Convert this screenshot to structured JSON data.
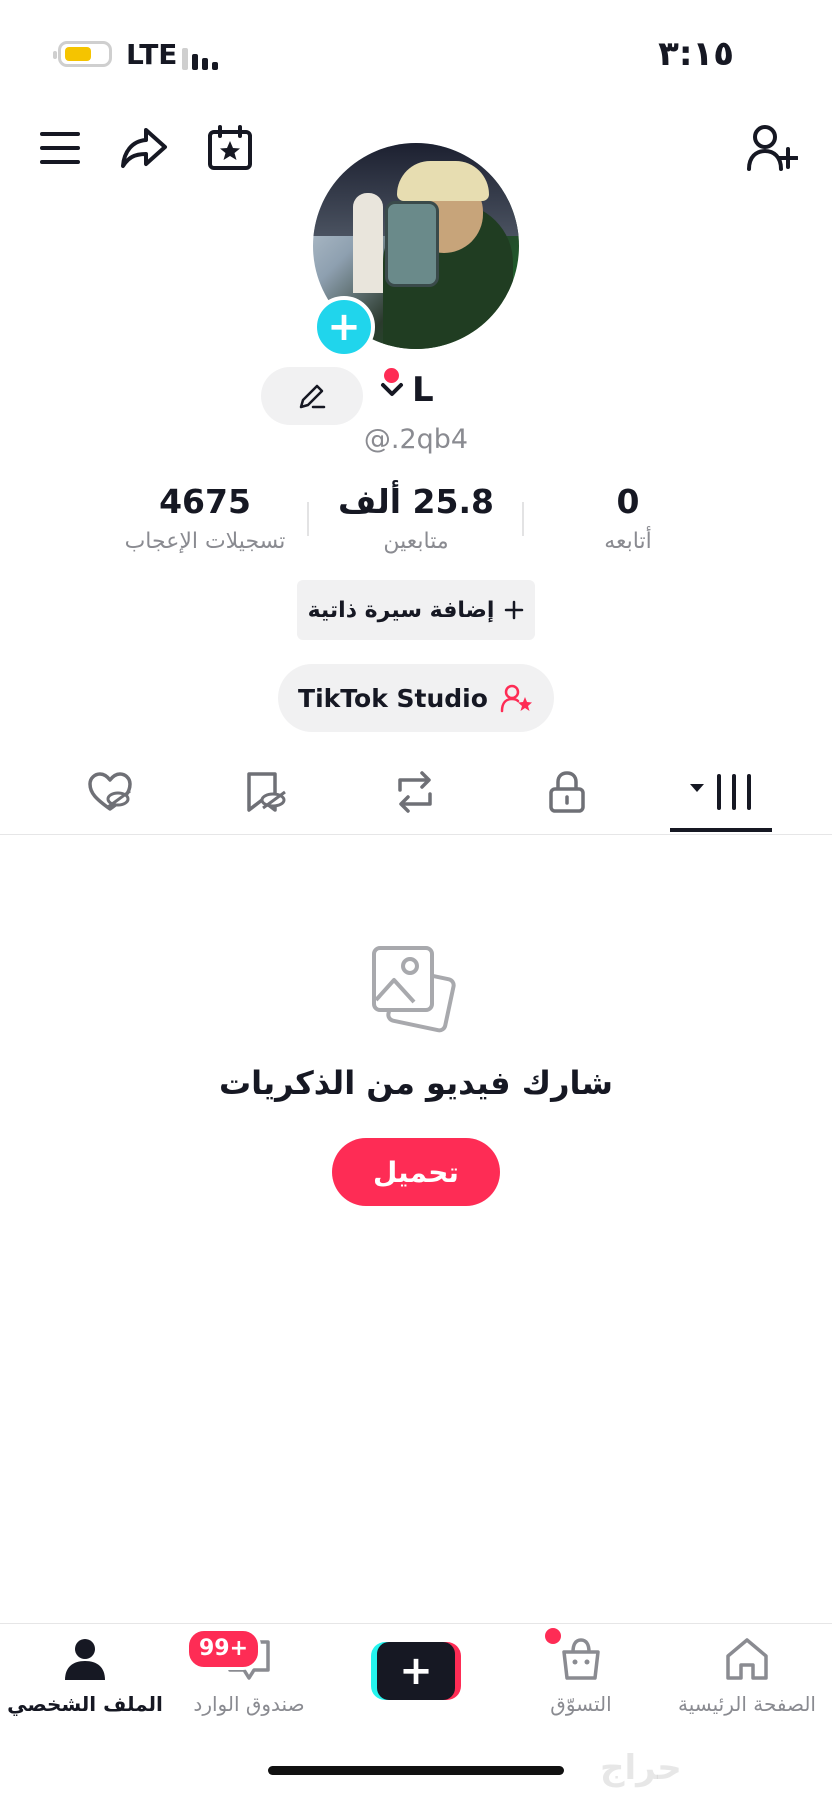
{
  "status_bar": {
    "time": "٣:١٥",
    "network": "LTE"
  },
  "profile": {
    "name": "L",
    "username": "@.2qb4"
  },
  "stats": {
    "following_count": "0",
    "following_label": "أتابعه",
    "followers_count": "25.8 ألف",
    "followers_label": "متابعين",
    "likes_count": "4675",
    "likes_label": "تسجيلات الإعجاب"
  },
  "buttons": {
    "add_bio": "إضافة سيرة ذاتية",
    "studio": "TikTok Studio"
  },
  "empty_state": {
    "title": "شارك فيديو من الذكريات",
    "upload": "تحميل"
  },
  "bottom_nav": {
    "profile": "الملف الشخصي",
    "inbox": "صندوق الوارد",
    "inbox_badge": "99+",
    "shop": "التسوّق",
    "home": "الصفحة الرئيسية"
  },
  "watermark": "حراج",
  "colors": {
    "accent": "#fe2c55",
    "cyan": "#25f4ee",
    "text": "#161823",
    "muted": "#8a8b91"
  }
}
